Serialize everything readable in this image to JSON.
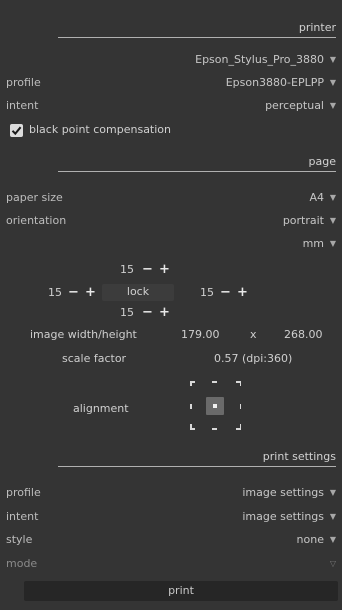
{
  "printer_section": {
    "title": "printer",
    "printer_name": "Epson_Stylus_Pro_3880",
    "profile_label": "profile",
    "profile_value": "Epson3880-EPLPP",
    "intent_label": "intent",
    "intent_value": "perceptual",
    "bpc_label": "black point compensation",
    "bpc_checked": true
  },
  "page_section": {
    "title": "page",
    "paper_size_label": "paper size",
    "paper_size_value": "A4",
    "orientation_label": "orientation",
    "orientation_value": "portrait",
    "unit_value": "mm",
    "margins": {
      "top": "15",
      "left": "15",
      "right": "15",
      "bottom": "15",
      "lock_label": "lock"
    },
    "image_wh_label": "image width/height",
    "image_width": "179.00",
    "image_x": "x",
    "image_height": "268.00",
    "scale_label": "scale factor",
    "scale_value": "0.57 (dpi:360)",
    "alignment_label": "alignment"
  },
  "print_settings_section": {
    "title": "print settings",
    "profile_label": "profile",
    "profile_value": "image settings",
    "intent_label": "intent",
    "intent_value": "image settings",
    "style_label": "style",
    "style_value": "none",
    "mode_label": "mode"
  },
  "print_button_label": "print",
  "icons": {
    "dropdown": "▼",
    "dropdown_disabled": "▽",
    "plus": "+",
    "minus": "−"
  }
}
